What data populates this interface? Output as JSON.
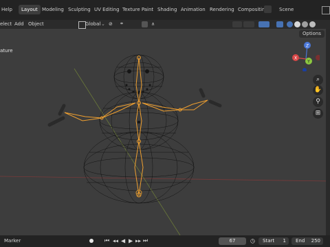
{
  "topbar": {
    "menu_help": "Help",
    "tabs": [
      "Layout",
      "Modeling",
      "Sculpting",
      "UV Editing",
      "Texture Paint",
      "Shading",
      "Animation",
      "Rendering",
      "Compositin"
    ],
    "scene": "Scene"
  },
  "header": {
    "menu_select": "elect",
    "menu_add": "Add",
    "menu_object": "Object",
    "orientation": "Global",
    "options": "Options"
  },
  "viewport": {
    "label": "ature"
  },
  "gizmo": {
    "z": "Z",
    "y": "Y",
    "x": "X"
  },
  "statusbar": {
    "marker": "Marker",
    "current_frame": "67",
    "start_label": "Start",
    "start_value": "1",
    "end_label": "End",
    "end_value": "250"
  },
  "colors": {
    "accent": "#4772b3",
    "bone": "#f0a030",
    "wire": "#000000"
  }
}
